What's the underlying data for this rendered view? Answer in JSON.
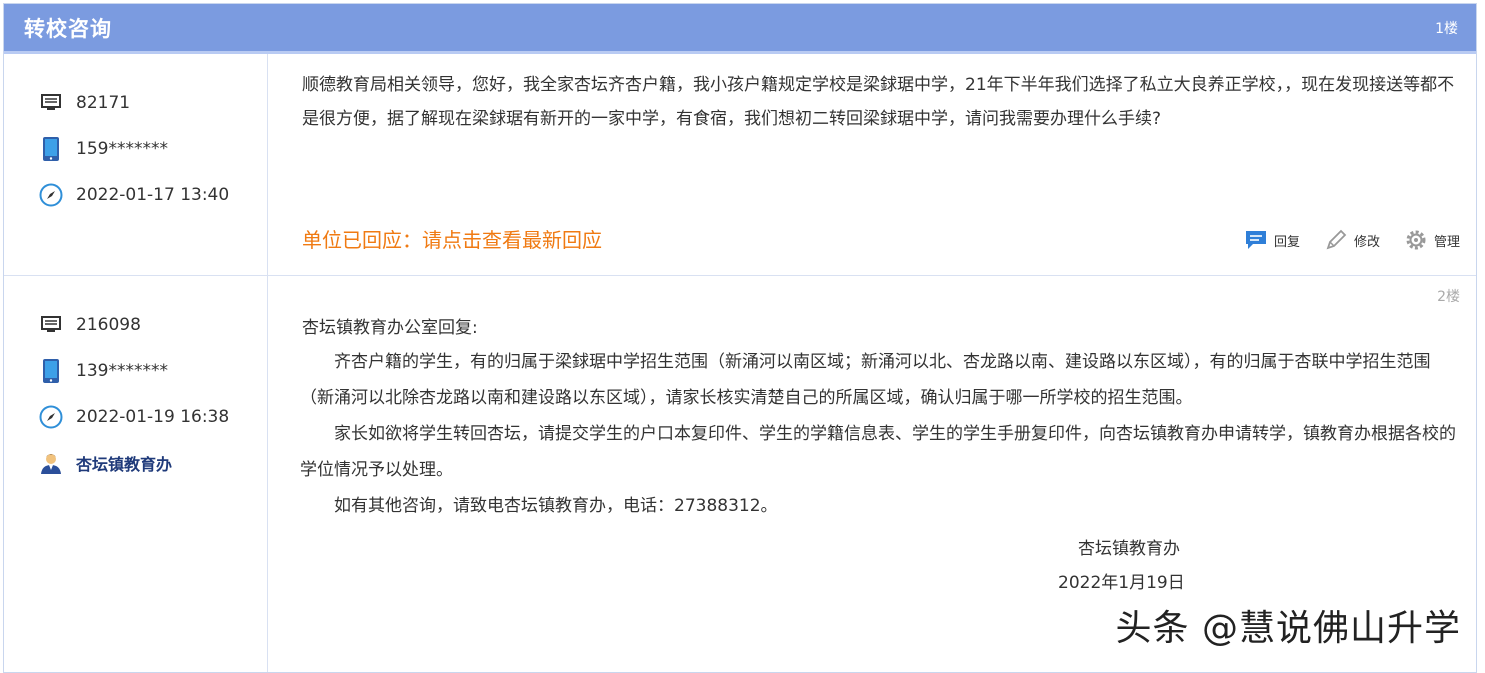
{
  "thread": {
    "title": "转校咨询",
    "floor_label": "1楼"
  },
  "post1": {
    "id": "82171",
    "phone": "159*******",
    "datetime": "2022-01-17 13:40",
    "body": "顺德教育局相关领导，您好，我全家杏坛齐杏户籍，我小孩户籍规定学校是梁銶琚中学，21年下半年我们选择了私立大良养正学校，，现在发现接送等都不是很方便，据了解现在梁銶琚有新开的一家中学，有食宿，我们想初二转回梁銶琚中学，请问我需要办理什么手续?",
    "response_link": "单位已回应：请点击查看最新回应",
    "actions": {
      "reply": "回复",
      "edit": "修改",
      "manage": "管理"
    }
  },
  "post2": {
    "floor_label": "2楼",
    "id": "216098",
    "phone": "139*******",
    "datetime": "2022-01-19 16:38",
    "department": "杏坛镇教育办",
    "reply_head": "杏坛镇教育办公室回复:",
    "paragraphs": [
      "齐杏户籍的学生，有的归属于梁銶琚中学招生范围（新涌河以南区域；新涌河以北、杏龙路以南、建设路以东区域），有的归属于杏联中学招生范围（新涌河以北除杏龙路以南和建设路以东区域），请家长核实清楚自己的所属区域，确认归属于哪一所学校的招生范围。",
      "家长如欲将学生转回杏坛，请提交学生的户口本复印件、学生的学籍信息表、学生的学生手册复印件，向杏坛镇教育办申请转学，镇教育办根据各校的学位情况予以处理。",
      "如有其他咨询，请致电杏坛镇教育办，电话：27388312。"
    ],
    "signature": "杏坛镇教育办",
    "signature_date": "2022年1月19日"
  },
  "watermark": "头条 @慧说佛山升学",
  "icons": [
    "monitor-icon",
    "phone-icon",
    "compass-icon",
    "user-icon",
    "reply-icon",
    "edit-icon",
    "gear-icon"
  ],
  "colors": {
    "header": "#7b9be0",
    "accent": "#f07a12",
    "dept": "#1f3a7a"
  }
}
